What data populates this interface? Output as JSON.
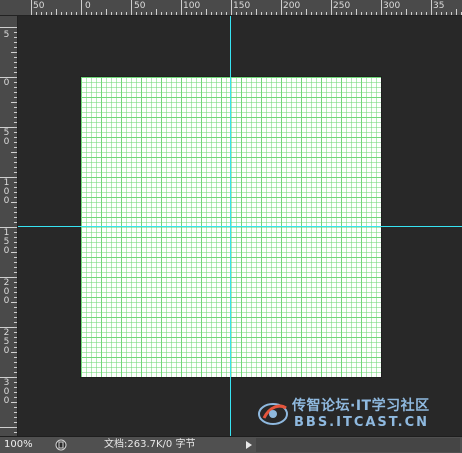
{
  "rulers": {
    "top_labels": [
      "50",
      "0",
      "50",
      "100",
      "150",
      "200",
      "250",
      "300",
      "35"
    ],
    "left_labels": [
      "5",
      "0",
      "50",
      "100",
      "150",
      "200",
      "250",
      "300"
    ]
  },
  "canvas": {
    "grid_color": "#71d87a",
    "background_color": "#ffffff"
  },
  "guides": {
    "color": "#37e3f2",
    "vertical_count": 1,
    "horizontal_count": 1
  },
  "status": {
    "zoom": "100%",
    "doc_info": "文档:263.7K/0 字节",
    "doc_icon": "document-status-icon",
    "arrow_icon": "play-right-icon"
  },
  "watermark": {
    "title": "传智论坛·IT学习社区",
    "url": "BBS.ITCAST.CN"
  }
}
